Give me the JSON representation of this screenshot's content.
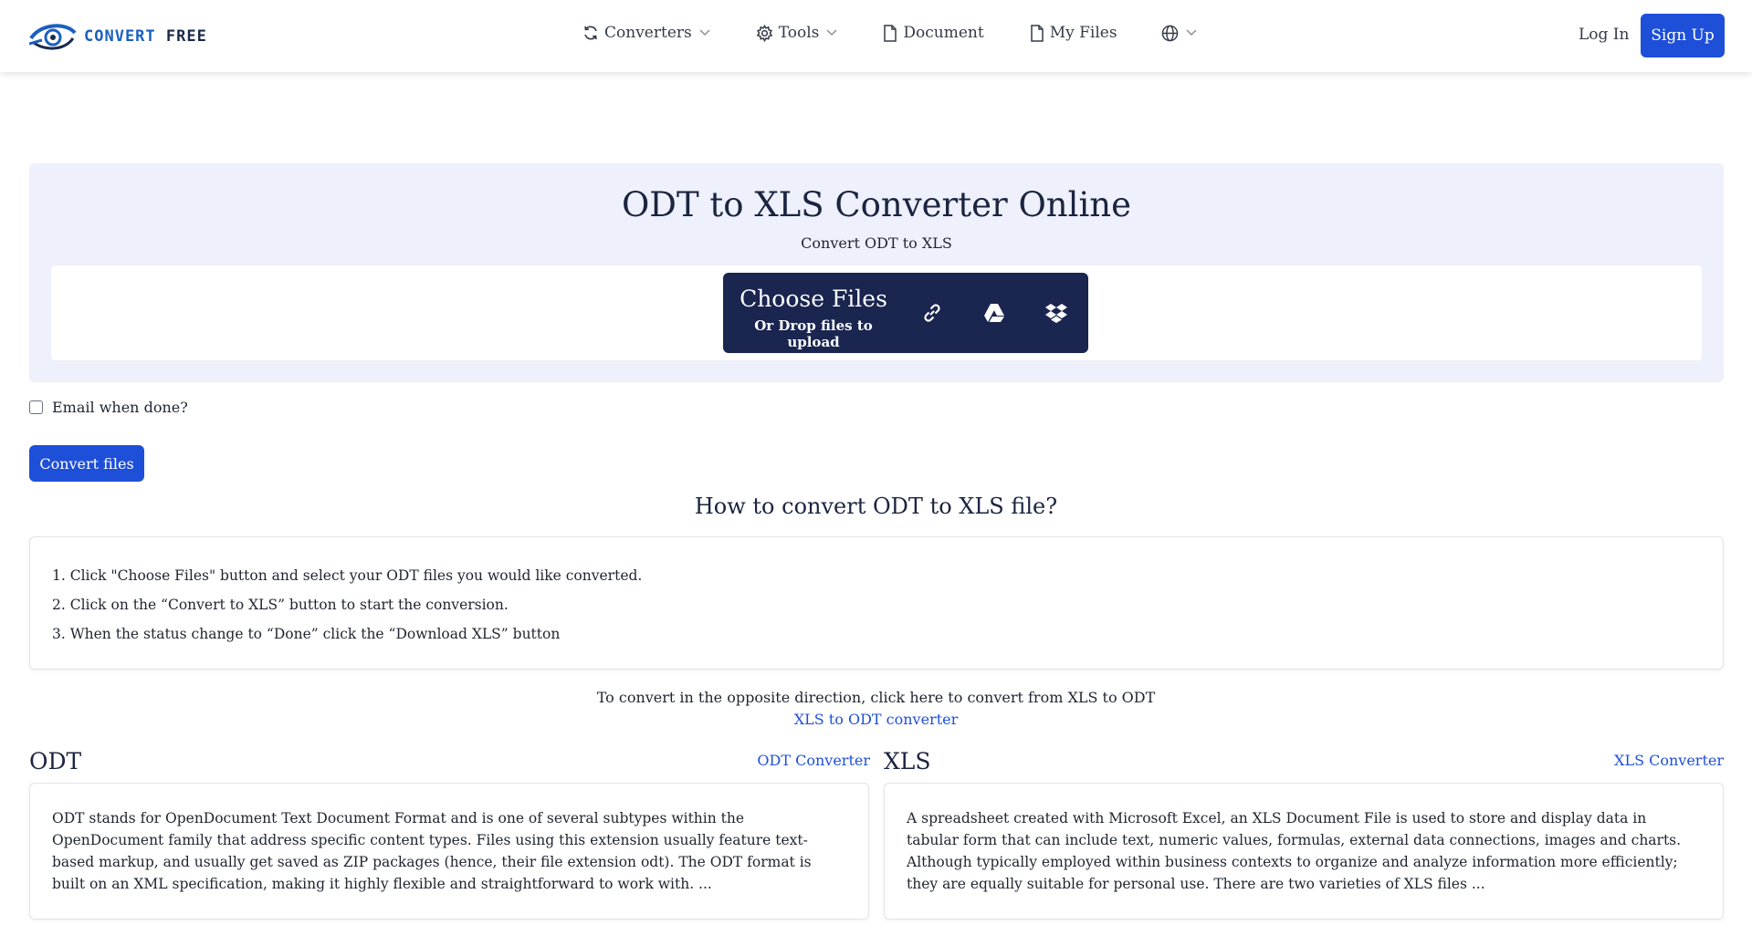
{
  "header": {
    "logo_text_1": "CONVERT",
    "logo_text_2": "FREE",
    "nav": [
      {
        "label": "Converters",
        "icon": "refresh-icon",
        "has_dropdown": true
      },
      {
        "label": "Tools",
        "icon": "gear-icon",
        "has_dropdown": true
      },
      {
        "label": "Document",
        "icon": "document-icon",
        "has_dropdown": false
      },
      {
        "label": "My Files",
        "icon": "file-icon",
        "has_dropdown": false
      },
      {
        "label": "",
        "icon": "globe-icon",
        "has_dropdown": true
      }
    ],
    "login_label": "Log In",
    "signup_label": "Sign Up"
  },
  "hero": {
    "title": "ODT to XLS Converter Online",
    "subtitle": "Convert ODT to XLS",
    "choose_files": "Choose Files",
    "drop_hint": "Or Drop files to upload",
    "upload_icons": [
      "link-icon",
      "google-drive-icon",
      "dropbox-icon"
    ]
  },
  "options": {
    "email_label": "Email when done?",
    "convert_label": "Convert files"
  },
  "howto": {
    "title": "How to convert ODT to XLS file?",
    "steps": [
      "1. Click \"Choose Files\" button and select your ODT files you would like converted.",
      "2. Click on the “Convert to XLS” button to start the conversion.",
      "3. When the status change to “Done” click the “Download XLS” button"
    ]
  },
  "opposite": {
    "text": "To convert in the opposite direction, click here to convert from XLS to ODT",
    "link": "XLS to ODT converter"
  },
  "formats": [
    {
      "title": "ODT",
      "link": "ODT Converter",
      "description": "ODT stands for OpenDocument Text Document Format and is one of several subtypes within the OpenDocument family that address specific content types. Files using this extension usually feature text-based markup, and usually get saved as ZIP packages (hence, their file extension odt). The ODT format is built on an XML specification, making it highly flexible and straightforward to work with. ..."
    },
    {
      "title": "XLS",
      "link": "XLS Converter",
      "description": "A spreadsheet created with Microsoft Excel, an XLS Document File is used to store and display data in tabular form that can include text, numeric values, formulas, external data connections, images and charts. Although typically employed within business contexts to organize and analyze information more efficiently; they are equally suitable for personal use. There are two varieties of XLS files ..."
    }
  ],
  "colors": {
    "accent": "#1e4fd8",
    "upload_box": "#1a2550",
    "hero_bg": "#eef0fb"
  }
}
